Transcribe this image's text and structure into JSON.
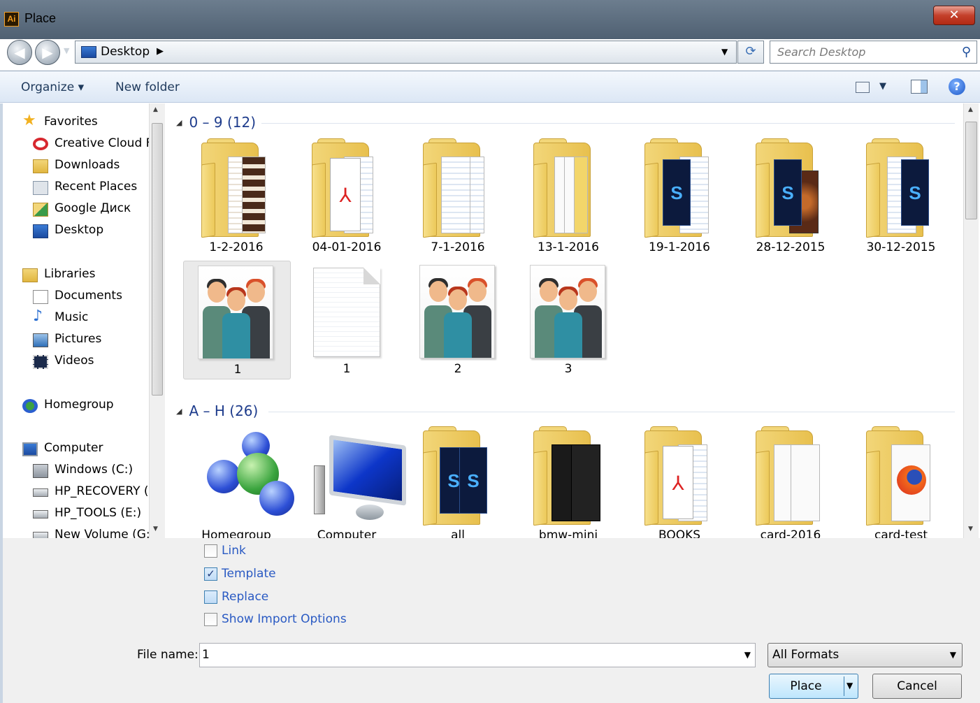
{
  "window": {
    "title": "Place",
    "app_icon_text": "Ai",
    "close_label": "✕"
  },
  "address": {
    "location": "Desktop",
    "search_placeholder": "Search Desktop"
  },
  "toolbar": {
    "organize_label": "Organize ▾",
    "new_folder_label": "New folder"
  },
  "nav": {
    "favorites": "Favorites",
    "creative_cloud": "Creative Cloud Fi",
    "downloads": "Downloads",
    "recent_places": "Recent Places",
    "google_drive": "Google Диск",
    "desktop": "Desktop",
    "libraries": "Libraries",
    "documents": "Documents",
    "music": "Music",
    "pictures": "Pictures",
    "videos": "Videos",
    "homegroup": "Homegroup",
    "computer": "Computer",
    "windows_c": "Windows (C:)",
    "hp_recovery": "HP_RECOVERY (D",
    "hp_tools": "HP_TOOLS (E:)",
    "new_volume": "New Volume (G:)"
  },
  "groups": {
    "g1": {
      "header": "0 – 9 (12)"
    },
    "g2": {
      "header": "A – H (26)"
    }
  },
  "files": {
    "f1": "1-2-2016",
    "f2": "04-01-2016",
    "f3": "7-1-2016",
    "f4": "13-1-2016",
    "f5": "19-1-2016",
    "f6": "28-12-2015",
    "f7": "30-12-2015",
    "f8": "1",
    "f9": "1",
    "f10": "2",
    "f11": "3",
    "f12": "Homegroup",
    "f13": "Computer",
    "f14": "all",
    "f15": "bmw-mini",
    "f16": "BOOKS",
    "f17": "card-2016",
    "f18": "card-test"
  },
  "options": {
    "link": {
      "label": "Link",
      "checked": false
    },
    "template": {
      "label": "Template",
      "checked": true,
      "mark": "✓"
    },
    "replace": {
      "label": "Replace",
      "checked": false
    },
    "show_import": {
      "label": "Show Import Options",
      "checked": false
    }
  },
  "footer": {
    "file_name_label": "File name:",
    "file_name_value": "1",
    "format_value": "All Formats",
    "place_label": "Place",
    "cancel_label": "Cancel"
  },
  "icons": {
    "dropdown": "▼",
    "arrow_right": "▶",
    "collapse": "◢",
    "search": "⚲",
    "help": "?",
    "back": "◀",
    "forward": "▶",
    "refresh": "⟳",
    "ps": "S",
    "pdf": "⅄"
  },
  "colors": {
    "link_blue": "#2a5ac3",
    "group_blue": "#1e3c8c",
    "titlebar": "#5f7082",
    "selected": "#eaeaea"
  }
}
